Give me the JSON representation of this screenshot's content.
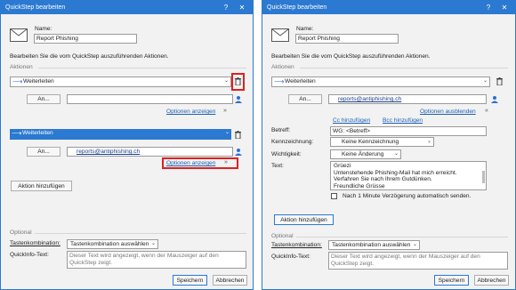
{
  "left": {
    "title": "QuickStep bearbeiten",
    "help": "?",
    "close": "✕",
    "name_label": "Name:",
    "name_value": "Report Phishing",
    "instruction": "Bearbeiten Sie die vom QuickStep auszuführenden Aktionen.",
    "actions_header": "Aktionen",
    "action1": "Weiterleiten",
    "to_button": "An...",
    "options_show1": "Optionen anzeigen",
    "action2": "Weiterleiten",
    "recipient": "reports@antiphishing.ch",
    "options_show2": "Optionen anzeigen",
    "add_action": "Aktion hinzufügen",
    "optional_header": "Optional",
    "shortcut_label": "Tastenkombination:",
    "shortcut_value": "Tastenkombination auswählen",
    "tooltip_label": "QuickInfo-Text:",
    "tooltip_text": "Dieser Text wird angezeigt, wenn der Mauszeiger auf den QuickStep zeigt.",
    "save": "Speichern",
    "cancel": "Abbrechen"
  },
  "right": {
    "title": "QuickStep bearbeiten",
    "help": "?",
    "close": "✕",
    "name_label": "Name:",
    "name_value": "Report Phishing",
    "instruction": "Bearbeiten Sie die vom QuickStep auszuführenden Aktionen.",
    "actions_header": "Aktionen",
    "action1": "Weiterleiten",
    "to_button": "An...",
    "recipient": "reports@antiphishing.ch",
    "options_hide": "Optionen ausblenden",
    "cc": "Cc hinzufügen",
    "bcc": "Bcc hinzufügen",
    "subject_label": "Betreff:",
    "subject_value": "WG: <Betreff>",
    "flag_label": "Kennzeichnung:",
    "flag_value": "Keine Kennzeichnung",
    "importance_label": "Wichtigkeit:",
    "importance_value": "Keine Änderung",
    "text_label": "Text:",
    "text_lines": [
      "Grüezi",
      "Untenstehende Phishing-Mail hat mich erreicht.",
      "Verfahren Sie nach Ihrem Gutdünken.",
      "Freundliche Grüsse"
    ],
    "delay": "Nach 1 Minute Verzögerung automatisch senden.",
    "add_action": "Aktion hinzufügen",
    "optional_header": "Optional",
    "shortcut_label": "Tastenkombination:",
    "shortcut_value": "Tastenkombination auswählen",
    "tooltip_label": "QuickInfo-Text:",
    "tooltip_text": "Dieser Text wird angezeigt, wenn der Mauszeiger auf den QuickStep zeigt.",
    "save": "Speichern",
    "cancel": "Abbrechen"
  }
}
